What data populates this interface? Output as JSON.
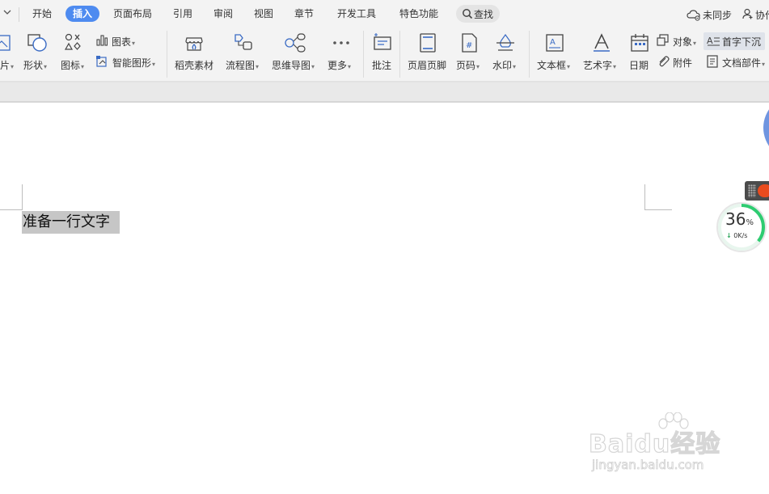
{
  "menubar": {
    "tabs": [
      "开始",
      "插入",
      "页面布局",
      "引用",
      "审阅",
      "视图",
      "章节",
      "开发工具",
      "特色功能"
    ],
    "active_tab": "插入",
    "search_label": "查找",
    "sync_label": "未同步",
    "collab_label": "协作"
  },
  "ribbon": {
    "picture_label": "片",
    "shape_label": "形状",
    "icons_label": "图标",
    "chart_label": "图表",
    "smart_shape_label": "智能图形",
    "daoke_label": "稻壳素材",
    "flowchart_label": "流程图",
    "mindmap_label": "思维导图",
    "more_label": "更多",
    "comment_label": "批注",
    "header_footer_label": "页眉页脚",
    "page_number_label": "页码",
    "watermark_label": "水印",
    "textbox_label": "文本框",
    "wordart_label": "艺术字",
    "date_label": "日期",
    "object_label": "对象",
    "attachment_label": "附件",
    "drop_cap_label": "首字下沉",
    "doc_parts_label": "文档部件"
  },
  "document": {
    "selected_text": "准备一行文字"
  },
  "speed_widget": {
    "percent": "36",
    "percent_unit": "%",
    "rate": "0K/s",
    "progress_fraction": 0.36
  },
  "watermark": {
    "brand": "Baidu经验",
    "url": "jingyan.baidu.com"
  },
  "colors": {
    "active_tab": "#4e8bf0",
    "selection": "#c6c6c6",
    "speed_ring": "#2ecc71"
  }
}
